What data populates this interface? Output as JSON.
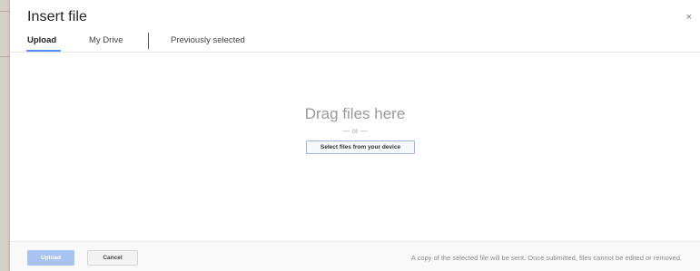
{
  "dialog": {
    "title": "Insert file",
    "close_glyph": "×"
  },
  "tabs": [
    {
      "label": "Upload",
      "active": true
    },
    {
      "label": "My Drive",
      "active": false
    },
    {
      "label": "Previously selected",
      "active": false
    }
  ],
  "drop_area": {
    "heading": "Drag files here",
    "or_text": "— or —",
    "select_button_label": "Select files from your device"
  },
  "footer": {
    "upload_label": "Upload",
    "cancel_label": "Cancel",
    "note": "A copy of the selected file will be sent. Once submitted, files cannot be edited or removed."
  },
  "colors": {
    "accent": "#4d90fe",
    "upload_button_disabled": "#a8c3f0"
  },
  "icons": {
    "close": "close-icon"
  }
}
